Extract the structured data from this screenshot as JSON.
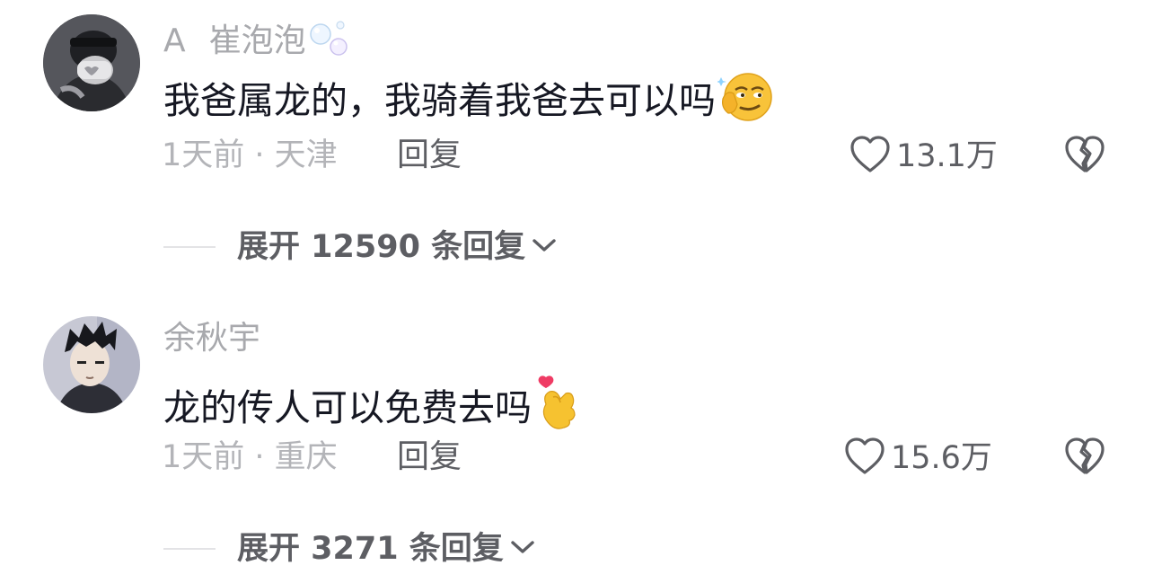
{
  "comments": [
    {
      "initial": "A",
      "username": "崔泡泡",
      "username_emoji": "bubbles-icon",
      "text": "我爸属龙的，我骑着我爸去可以吗",
      "text_emoji": "smirking-face-icon",
      "time_location": "1天前 · 天津",
      "reply_label": "回复",
      "likes": "13.1万",
      "expand_label": "展开 12590 条回复"
    },
    {
      "username": "余秋宇",
      "text": "龙的传人可以免费去吗",
      "text_emoji": "finger-heart-icon",
      "time_location": "1天前 · 重庆",
      "reply_label": "回复",
      "likes": "15.6万",
      "expand_label": "展开 3271 条回复"
    }
  ],
  "colors": {
    "primary_text": "#161823",
    "secondary_text": "#a8a9ad",
    "action_text": "#5d5e63",
    "divider": "#e3e3e6"
  }
}
